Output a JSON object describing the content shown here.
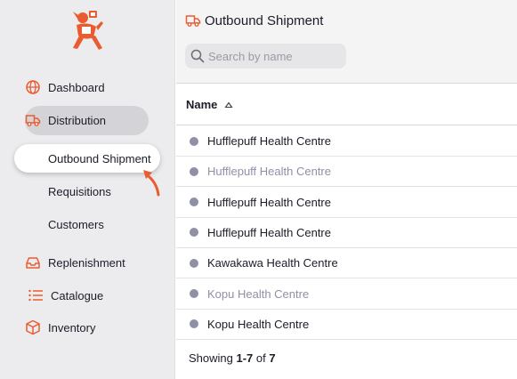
{
  "colors": {
    "accent": "#e95c30",
    "sidebar_bg": "#ececee",
    "dot": "#8f90a6"
  },
  "sidebar": {
    "logo": "mascot-logo",
    "items": [
      {
        "label": "Dashboard",
        "icon": "globe-icon"
      },
      {
        "label": "Distribution",
        "icon": "truck-icon",
        "expanded": true
      },
      {
        "label": "Replenishment",
        "icon": "inbox-icon"
      },
      {
        "label": "Catalogue",
        "icon": "list-icon"
      },
      {
        "label": "Inventory",
        "icon": "box-icon"
      }
    ],
    "sub_items": [
      {
        "label": "Outbound Shipment",
        "active": true
      },
      {
        "label": "Requisitions"
      },
      {
        "label": "Customers"
      }
    ]
  },
  "header": {
    "title": "Outbound Shipment",
    "search_placeholder": "Search by name"
  },
  "table": {
    "column": "Name",
    "rows": [
      {
        "name": "Hufflepuff Health Centre",
        "muted": false
      },
      {
        "name": "Hufflepuff Health Centre",
        "muted": true
      },
      {
        "name": "Hufflepuff Health Centre",
        "muted": false
      },
      {
        "name": "Hufflepuff Health Centre",
        "muted": false
      },
      {
        "name": "Kawakawa Health Centre",
        "muted": false
      },
      {
        "name": "Kopu Health Centre",
        "muted": true
      },
      {
        "name": "Kopu Health Centre",
        "muted": false
      }
    ]
  },
  "footer": {
    "prefix": "Showing ",
    "range": "1-7",
    "middle": " of ",
    "total": "7"
  }
}
